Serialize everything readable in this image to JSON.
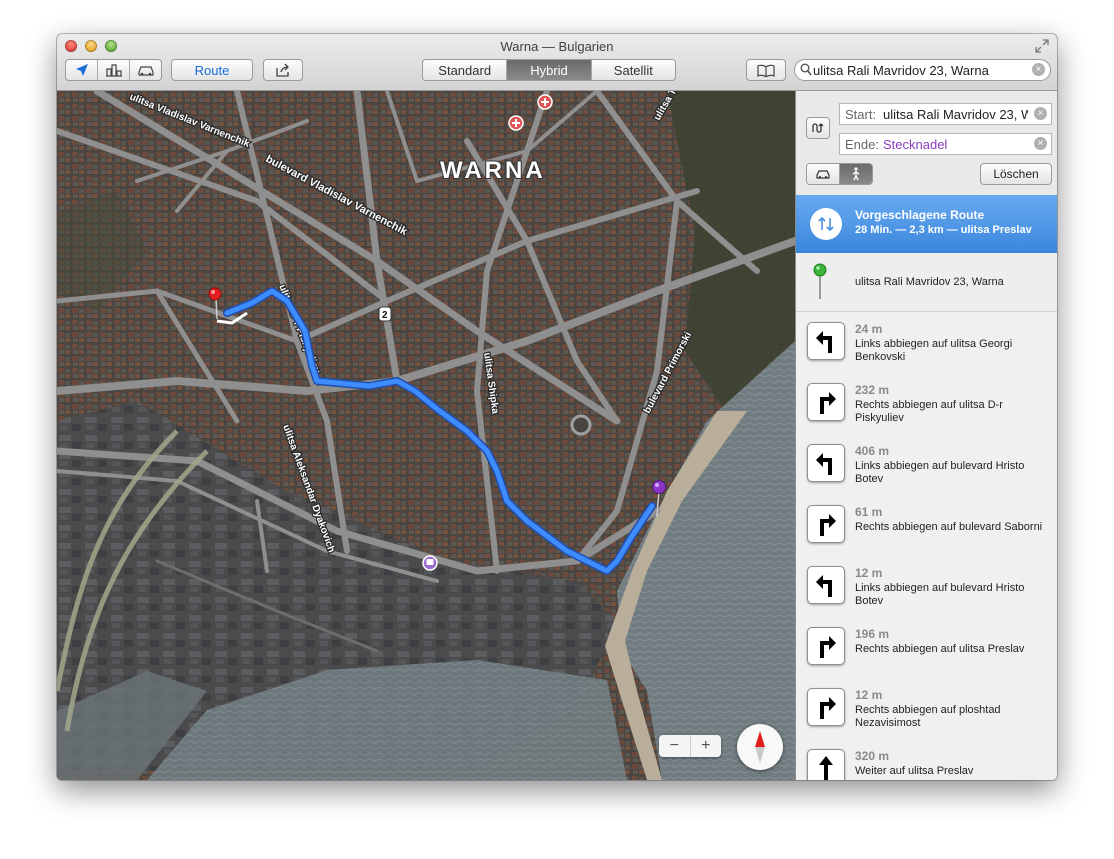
{
  "window": {
    "title": "Warna — Bulgarien"
  },
  "toolbar": {
    "route_label": "Route",
    "map_types": [
      "Standard",
      "Hybrid",
      "Satellit"
    ],
    "active_map_type": "Hybrid",
    "search_value": "ulitsa Rali Mavridov 23, Warna"
  },
  "map": {
    "city_label": "WARNA",
    "streets": [
      "ulitsa Vladislav Varnenchik",
      "bulevard Vladislav Varnenchik",
      "ulitsa D-r Piskyuliev",
      "ulitsa Shipka",
      "bulevard Primorski",
      "ulitsa Aleksandar Dyakovich"
    ],
    "road_shield": "2",
    "zoom_out": "−",
    "zoom_in": "+"
  },
  "directions": {
    "start_label": "Start:",
    "start_value": "ulitsa Rali Mavridov 23, Warna",
    "end_label": "Ende:",
    "end_value": "Stecknadel",
    "clear_label": "Löschen",
    "route_title": "Vorgeschlagene Route",
    "route_summary": "28 Min. — 2,3 km — ulitsa Preslav",
    "start_address": "ulitsa Rali Mavridov 23, Warna",
    "steps": [
      {
        "dist": "24 m",
        "turn": "left",
        "text": "Links abbiegen auf ulitsa Georgi Benkovski"
      },
      {
        "dist": "232 m",
        "turn": "right",
        "text": "Rechts abbiegen auf ulitsa D-r Piskyuliev"
      },
      {
        "dist": "406 m",
        "turn": "left",
        "text": "Links abbiegen auf bulevard Hristo Botev"
      },
      {
        "dist": "61 m",
        "turn": "right",
        "text": "Rechts abbiegen auf bulevard Saborni"
      },
      {
        "dist": "12 m",
        "turn": "left",
        "text": "Links abbiegen auf bulevard Hristo Botev"
      },
      {
        "dist": "196 m",
        "turn": "right",
        "text": "Rechts abbiegen auf ulitsa Preslav"
      },
      {
        "dist": "12 m",
        "turn": "right",
        "text": "Rechts abbiegen auf ploshtad Nezavisimost"
      },
      {
        "dist": "320 m",
        "turn": "straight",
        "text": "Weiter auf ulitsa Preslav"
      }
    ]
  },
  "colors": {
    "route_blue": "#2f7bf0",
    "selected_row": "#4a93e4",
    "end_text": "#8a3cc2",
    "accent": "#1a6fd6"
  },
  "icons": {
    "location": "location-arrow-icon",
    "3d": "3d-buildings-icon",
    "traffic": "car-icon",
    "share": "share-icon",
    "bookmarks": "bookmarks-icon",
    "search": "search-icon",
    "swap": "swap-icon",
    "drive": "car-icon",
    "walk": "walking-icon"
  }
}
